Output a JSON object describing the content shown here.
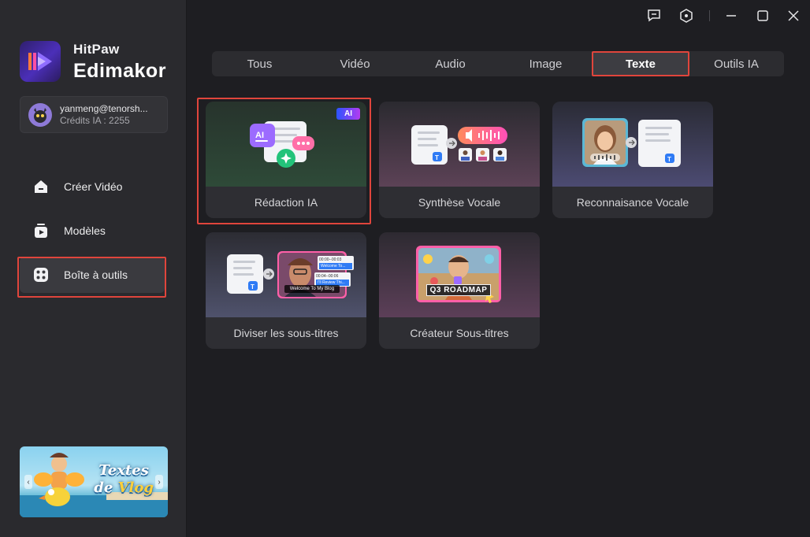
{
  "brand": {
    "sub": "HitPaw",
    "name": "Edimakor"
  },
  "account": {
    "email": "yanmeng@tenorsh...",
    "credits": "Crédits IA : 2255"
  },
  "nav": {
    "items": [
      {
        "label": "Créer Vidéo",
        "icon": "home-icon"
      },
      {
        "label": "Modèles",
        "icon": "templates-icon"
      },
      {
        "label": "Boîte à outils",
        "icon": "toolbox-icon"
      }
    ],
    "active": "Boîte à outils"
  },
  "promo": {
    "line1": "Textes",
    "line2_a": "de ",
    "line2_b": "Vlog"
  },
  "titlebar": {
    "icons": [
      "feedback-icon",
      "settings-icon",
      "minimize-icon",
      "maximize-icon",
      "close-icon"
    ]
  },
  "tabs": [
    "Tous",
    "Vidéo",
    "Audio",
    "Image",
    "Texte",
    "Outils IA"
  ],
  "active_tab": "Texte",
  "cards": [
    {
      "label": "Rédaction IA",
      "badge": "AI"
    },
    {
      "label": "Synthèse Vocale"
    },
    {
      "label": "Reconnaisance Vocale"
    },
    {
      "label": "Diviser les sous-titres",
      "caption_1": "00:00--00:03",
      "caption_2": "Welcome To...",
      "caption_3": "00:04--00:06",
      "caption_4": "I'll Review Thi...",
      "subtitle": "Welcome To My Blog"
    },
    {
      "label": "Créateur Sous-titres",
      "overlay": "Q3 ROADMAP"
    }
  ],
  "colors": {
    "highlight": "#e0453c",
    "accent": "#2f7bf5",
    "bg": "#1e1e22",
    "sidebar": "#2a2a2e"
  }
}
